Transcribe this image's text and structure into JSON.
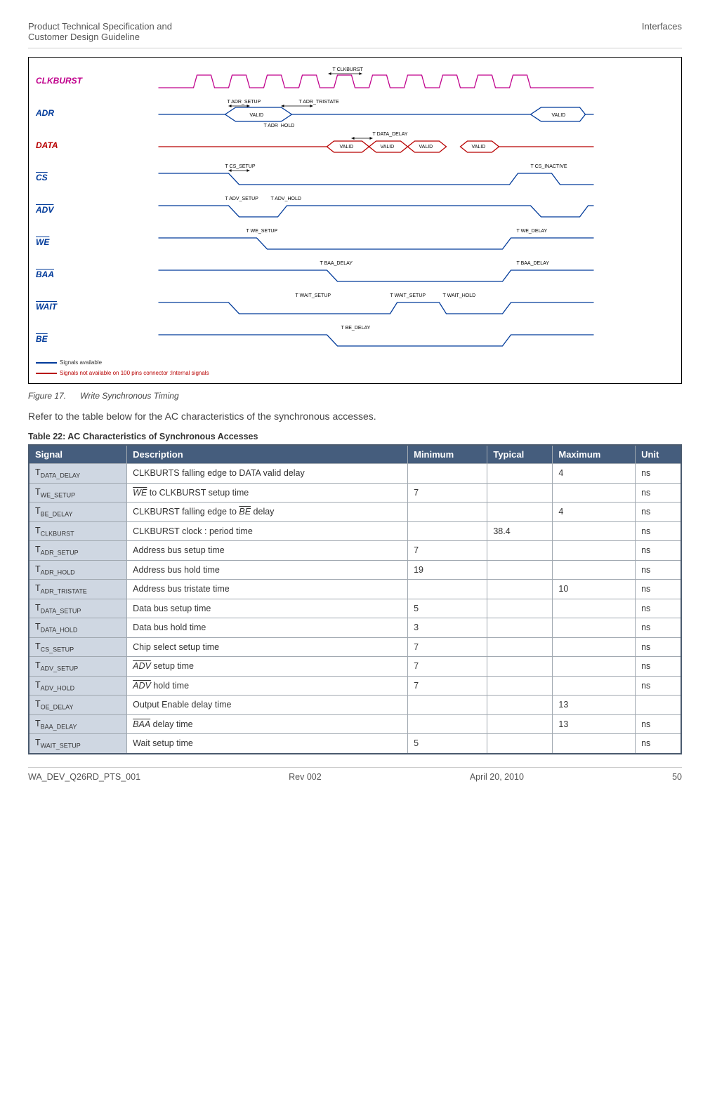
{
  "header": {
    "left1": "Product Technical Specification and",
    "left2": "Customer Design Guideline",
    "right": "Interfaces"
  },
  "diagram": {
    "signals": [
      "CLKBURST",
      "ADR",
      "DATA",
      "CS",
      "ADV",
      "WE",
      "BAA",
      "WAIT",
      "BE"
    ],
    "tparams": {
      "clkburst": "T CLKBURST",
      "adr_setup": "T ADR_SETUP",
      "adr_tristate": "T ADR_TRISTATE",
      "adr_hold": "T ADR_HOLD",
      "data_delay": "T DATA_DELAY",
      "cs_setup": "T CS_SETUP",
      "cs_inactive": "T CS_INACTIVE",
      "adv_setup": "T ADV_SETUP",
      "adv_hold": "T ADV_HOLD",
      "we_setup": "T WE_SETUP",
      "we_delay": "T WE_DELAY",
      "baa_delay": "T BAA_DELAY",
      "wait_setup": "T WAIT_SETUP",
      "wait_hold": "T WAIT_HOLD",
      "be_delay": "T BE_DELAY"
    },
    "valid": "VALID",
    "legend": {
      "a": "Signals available",
      "b": "Signals not available on 100 pins connector :Internal signals"
    }
  },
  "caption": {
    "num": "Figure 17.",
    "txt": "Write Synchronous Timing"
  },
  "intro": "Refer to the table below for the AC characteristics of the synchronous accesses.",
  "table": {
    "title": "Table 22:    AC Characteristics of Synchronous Accesses",
    "headers": [
      "Signal",
      "Description",
      "Minimum",
      "Typical",
      "Maximum",
      "Unit"
    ],
    "rows": [
      {
        "sig": "T",
        "sub": "DATA_DELAY",
        "desc_pre": "CLKBURTS falling edge to DATA valid delay",
        "over": "",
        "desc_post": "",
        "min": "",
        "typ": "",
        "max": "4",
        "unit": "ns"
      },
      {
        "sig": "T",
        "sub": "WE_SETUP",
        "desc_pre": "",
        "over": "WE",
        "desc_post": " to CLKBURST setup time",
        "min": "7",
        "typ": "",
        "max": "",
        "unit": "ns"
      },
      {
        "sig": "T",
        "sub": "BE_DELAY",
        "desc_pre": "CLKBURST falling edge to ",
        "over": "BE",
        "desc_post": " delay",
        "min": "",
        "typ": "",
        "max": "4",
        "unit": "ns"
      },
      {
        "sig": "T",
        "sub": "CLKBURST",
        "desc_pre": "CLKBURST clock :  period time",
        "over": "",
        "desc_post": "",
        "min": "",
        "typ": "38.4",
        "max": "",
        "unit": "ns"
      },
      {
        "sig": "T",
        "sub": "ADR_SETUP",
        "desc_pre": "Address bus setup time",
        "over": "",
        "desc_post": "",
        "min": "7",
        "typ": "",
        "max": "",
        "unit": "ns"
      },
      {
        "sig": "T",
        "sub": "ADR_HOLD",
        "desc_pre": "Address bus hold time",
        "over": "",
        "desc_post": "",
        "min": "19",
        "typ": "",
        "max": "",
        "unit": "ns"
      },
      {
        "sig": "T",
        "sub": "ADR_TRISTATE",
        "desc_pre": "Address bus tristate time",
        "over": "",
        "desc_post": "",
        "min": "",
        "typ": "",
        "max": "10",
        "unit": "ns"
      },
      {
        "sig": "T",
        "sub": "DATA_SETUP",
        "desc_pre": "Data bus setup time",
        "over": "",
        "desc_post": "",
        "min": "5",
        "typ": "",
        "max": "",
        "unit": "ns"
      },
      {
        "sig": "T",
        "sub": "DATA_HOLD",
        "desc_pre": "Data bus hold time",
        "over": "",
        "desc_post": "",
        "min": "3",
        "typ": "",
        "max": "",
        "unit": "ns"
      },
      {
        "sig": "T",
        "sub": "CS_SETUP",
        "desc_pre": "Chip select setup time",
        "over": "",
        "desc_post": "",
        "min": "7",
        "typ": "",
        "max": "",
        "unit": "ns"
      },
      {
        "sig": "T",
        "sub": "ADV_SETUP",
        "desc_pre": "",
        "over": "ADV",
        "desc_post": " setup time",
        "min": "7",
        "typ": "",
        "max": "",
        "unit": "ns"
      },
      {
        "sig": "T",
        "sub": "ADV_HOLD",
        "desc_pre": "",
        "over": "ADV",
        "desc_post": " hold time",
        "min": "7",
        "typ": "",
        "max": "",
        "unit": "ns"
      },
      {
        "sig": "T",
        "sub": "OE_DELAY",
        "desc_pre": "Output Enable delay time",
        "over": "",
        "desc_post": "",
        "min": "",
        "typ": "",
        "max": "13",
        "unit": ""
      },
      {
        "sig": "T",
        "sub": "BAA_DELAY",
        "desc_pre": "",
        "over": "BAA",
        "desc_post": " delay time",
        "min": "",
        "typ": "",
        "max": "13",
        "unit": "ns"
      },
      {
        "sig": "T",
        "sub": "WAIT_SETUP",
        "desc_pre": "Wait setup time",
        "over": "",
        "desc_post": "",
        "min": "5",
        "typ": "",
        "max": "",
        "unit": "ns"
      }
    ]
  },
  "footer": {
    "doc": "WA_DEV_Q26RD_PTS_001",
    "rev": "Rev 002",
    "date": "April 20, 2010",
    "page": "50"
  }
}
